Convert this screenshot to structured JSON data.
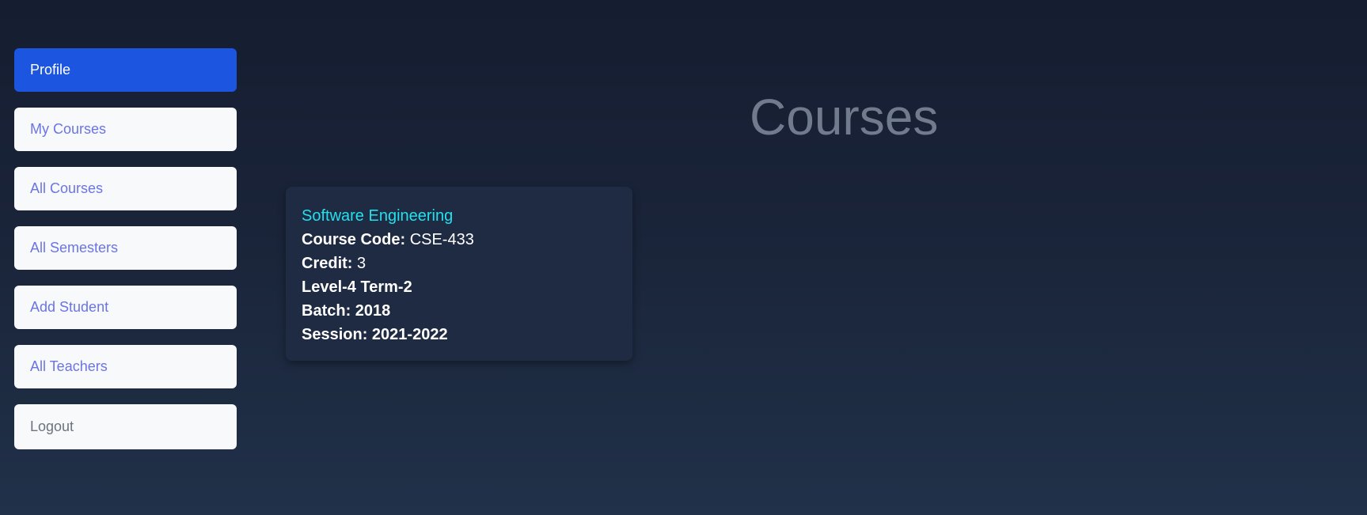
{
  "sidebar": {
    "items": [
      {
        "label": "Profile",
        "active": true
      },
      {
        "label": "My Courses"
      },
      {
        "label": "All Courses"
      },
      {
        "label": "All Semesters"
      },
      {
        "label": "Add Student"
      },
      {
        "label": "All Teachers"
      },
      {
        "label": "Logout"
      }
    ]
  },
  "main": {
    "title": "Courses",
    "course": {
      "name": "Software Engineering",
      "code_label": "Course Code:",
      "code": "CSE-433",
      "credit_label": "Credit:",
      "credit": "3",
      "level_term": "Level-4 Term-2",
      "batch": "Batch: 2018",
      "session": "Session: 2021-2022"
    }
  },
  "colors": {
    "active_nav": "#1c55e0",
    "nav_text": "#6b74e6",
    "course_title": "#22e0ee",
    "card_bg": "#1f2b42",
    "page_bg": "#1a2439"
  }
}
